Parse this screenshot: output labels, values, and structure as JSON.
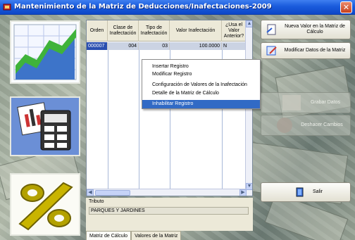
{
  "window": {
    "title": "Mantenimiento de la Matriz de Deducciones/Inafectaciones-2009",
    "close_glyph": "✕"
  },
  "grid": {
    "headers": [
      "Orden",
      "Clase de Inafectación",
      "Tipo de Inafectación",
      "Valor Inafectación",
      "¿Usa el Valor Anterior?"
    ],
    "rows": [
      {
        "orden": "000007",
        "clase": "004",
        "tipo": "03",
        "valor": "100.0000",
        "usa": "N"
      }
    ]
  },
  "context_menu": {
    "items": [
      "Insertar Registro",
      "Modificar Registro",
      "Configuración de Valores de la Inafectación",
      "Detalle de la Matriz de Cálculo",
      "Inhabilitar Registro"
    ],
    "highlighted_index": 4
  },
  "tributo": {
    "label": "Tributo",
    "value": "PARQUES Y JARDINES"
  },
  "tabs": [
    "Matriz de Cálculo",
    "Valores de la Matriz"
  ],
  "buttons": {
    "nueva_valor": "Nueva Valor en la Matriz de Cálculo",
    "modificar": "Modificar Datos de la Matriz",
    "grabar": "Grabar Datos",
    "deshacer": "Deshacer Cambios",
    "salir": "Salir"
  },
  "icons": {
    "chart": "chart-icon",
    "calculator": "calculator-icon",
    "percent": "percent-icon"
  },
  "colors": {
    "titlebar": "#1a5bdc",
    "selection": "#2a4fb0",
    "menu_highlight": "#316ac5"
  }
}
